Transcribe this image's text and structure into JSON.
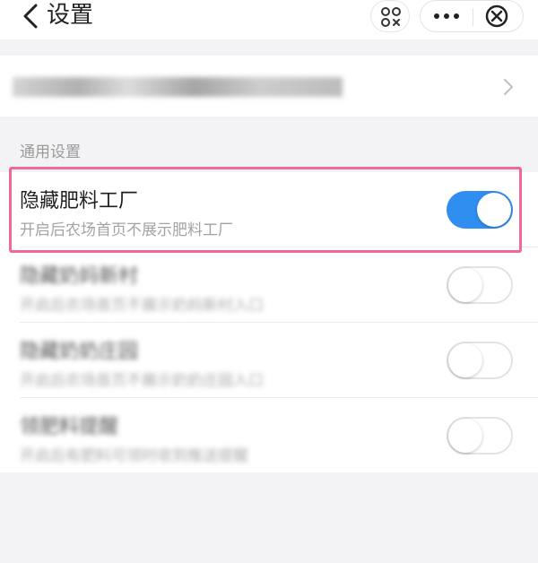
{
  "header": {
    "title": "设置",
    "back_icon": "chevron-left-icon",
    "scan_icon": "scan-icon",
    "more_icon": "more-dots-icon",
    "close_icon": "close-circle-icon"
  },
  "account": {
    "blurred": true,
    "chevron_icon": "chevron-right-icon"
  },
  "section": {
    "label": "通用设置"
  },
  "settings": [
    {
      "title": "隐藏肥料工厂",
      "desc": "开启后农场首页不展示肥料工厂",
      "enabled": true,
      "highlighted": true
    },
    {
      "title": "隐藏奶妈新村",
      "desc": "开启后农场首页不展示奶妈新村入口",
      "enabled": false,
      "blurred": true
    },
    {
      "title": "隐藏奶奶庄园",
      "desc": "开启后农场首页不展示奶奶庄园入口",
      "enabled": false,
      "blurred": true
    },
    {
      "title": "领肥料提醒",
      "desc": "开启后有肥料可领时收到推送提醒",
      "enabled": false,
      "blurred": true
    }
  ],
  "colors": {
    "toggle_on": "#2f8ef0",
    "highlight": "#ef6a9a"
  }
}
